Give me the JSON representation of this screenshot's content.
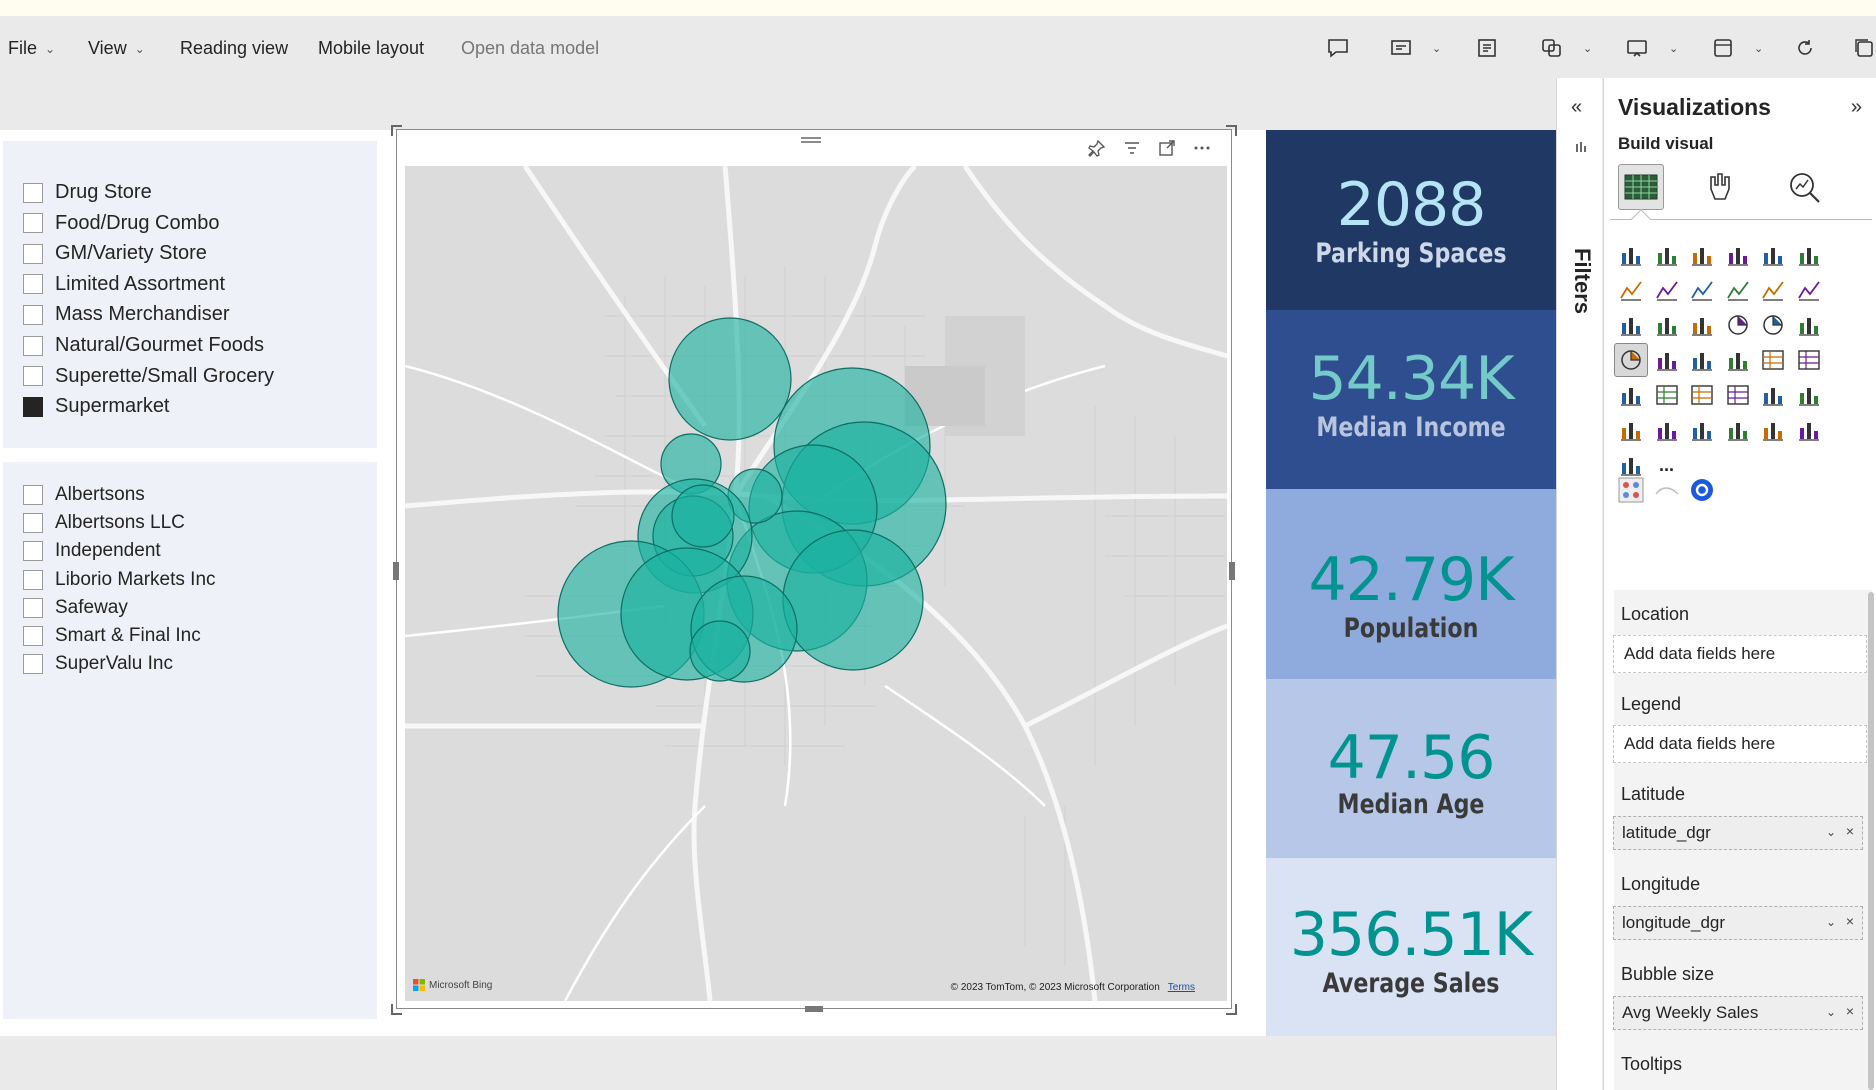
{
  "menu": {
    "file": "File",
    "view": "View",
    "reading_view": "Reading view",
    "mobile_layout": "Mobile layout",
    "open_data_model": "Open data model"
  },
  "slicer_store_type": {
    "items": [
      {
        "label": "Drug Store",
        "checked": false
      },
      {
        "label": "Food/Drug Combo",
        "checked": false
      },
      {
        "label": "GM/Variety Store",
        "checked": false
      },
      {
        "label": "Limited Assortment",
        "checked": false
      },
      {
        "label": "Mass Merchandiser",
        "checked": false
      },
      {
        "label": "Natural/Gourmet Foods",
        "checked": false
      },
      {
        "label": "Superette/Small Grocery",
        "checked": false
      },
      {
        "label": "Supermarket",
        "checked": true
      }
    ]
  },
  "slicer_company": {
    "items": [
      {
        "label": "Albertsons",
        "checked": false
      },
      {
        "label": "Albertsons LLC",
        "checked": false
      },
      {
        "label": "Independent",
        "checked": false
      },
      {
        "label": "Liborio Markets Inc",
        "checked": false
      },
      {
        "label": "Safeway",
        "checked": false
      },
      {
        "label": "Smart & Final Inc",
        "checked": false
      },
      {
        "label": "SuperValu Inc",
        "checked": false
      }
    ]
  },
  "map": {
    "bing_label": "Microsoft Bing",
    "copyright": "© 2023 TomTom, © 2023 Microsoft Corporation",
    "terms": "Terms",
    "bubble_color": "#1ab2a0"
  },
  "cards": [
    {
      "value": "2088",
      "label": "Parking Spaces",
      "bg": "#1f3864",
      "color": "#b4e4f5"
    },
    {
      "value": "54.34K",
      "label": "Median Income",
      "bg": "#2e4e8f",
      "color": "#74c9c9"
    },
    {
      "value": "42.79K",
      "label": "Population",
      "bg": "#8faadc",
      "color": "#00938f"
    },
    {
      "value": "47.56",
      "label": "Median Age",
      "bg": "#b6c7e7",
      "color": "#00938f"
    },
    {
      "value": "356.51K",
      "label": "Average Sales",
      "bg": "#dae3f3",
      "color": "#00938f"
    }
  ],
  "filters_pane": {
    "label": "Filters"
  },
  "viz_pane": {
    "title": "Visualizations",
    "build_visual": "Build visual",
    "more": "...",
    "wells": {
      "location": {
        "label": "Location",
        "placeholder": "Add data fields here"
      },
      "legend": {
        "label": "Legend",
        "placeholder": "Add data fields here"
      },
      "latitude": {
        "label": "Latitude",
        "field": "latitude_dgr"
      },
      "longitude": {
        "label": "Longitude",
        "field": "longitude_dgr"
      },
      "bubble_size": {
        "label": "Bubble size",
        "field": "Avg Weekly Sales"
      },
      "tooltips": {
        "label": "Tooltips"
      }
    }
  }
}
